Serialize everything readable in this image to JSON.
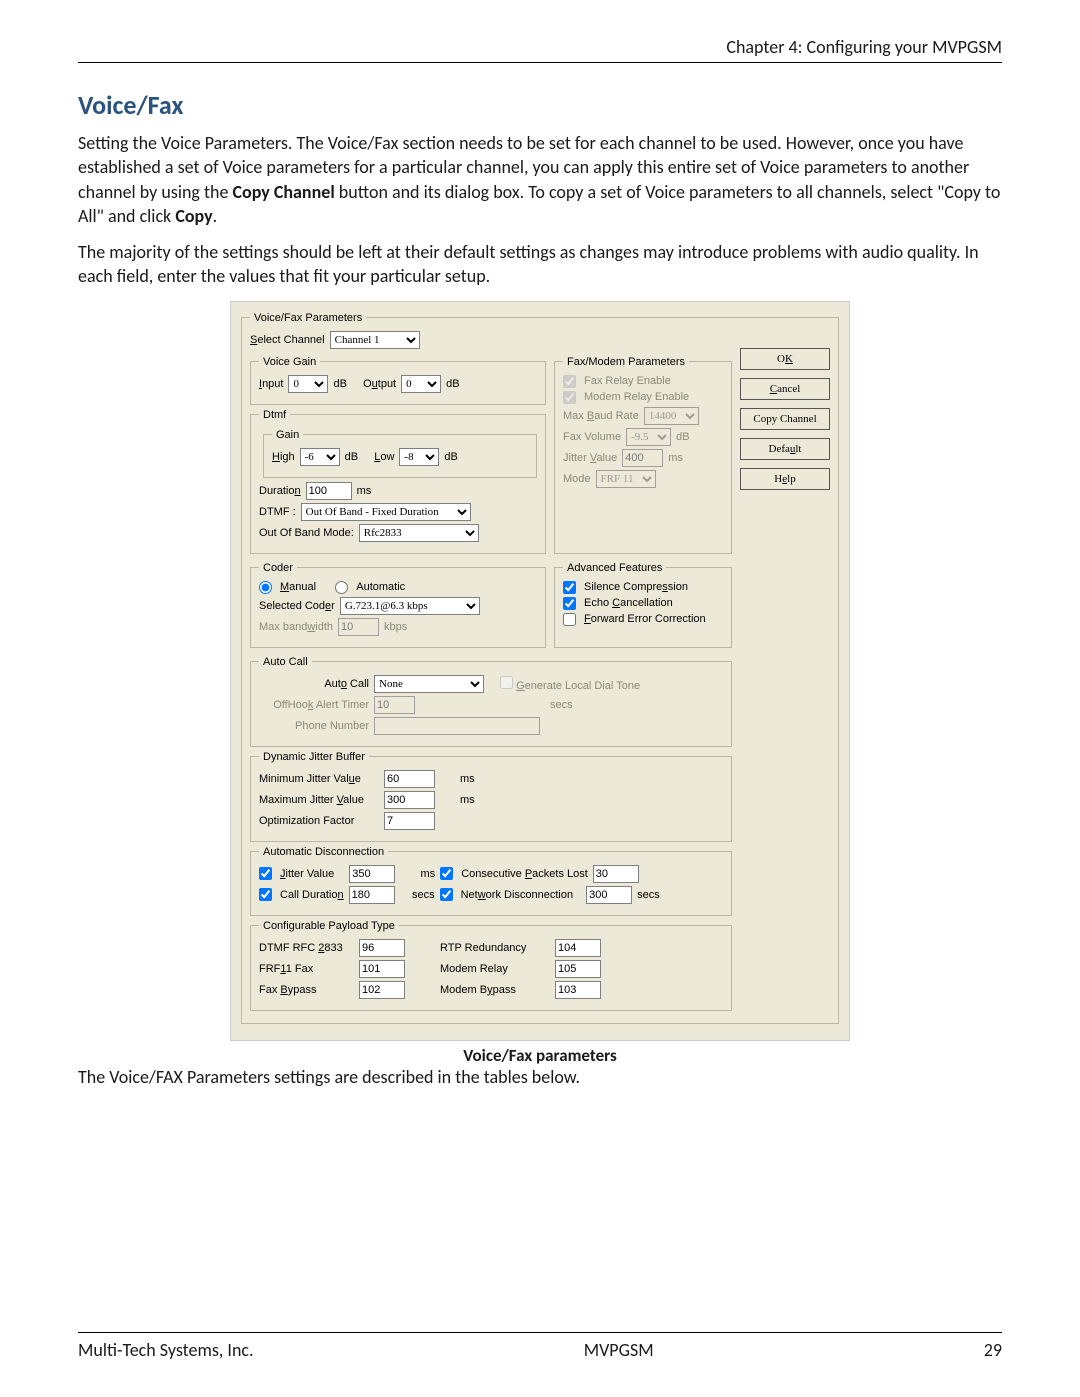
{
  "header": {
    "chapter": "Chapter 4: Configuring your MVPGSM"
  },
  "title": "Voice/Fax",
  "p1a": "Setting the Voice Parameters. The Voice/Fax section needs to be set for each channel to be used. However, once you have established a set of Voice parameters for a particular channel, you can apply this entire set of Voice parameters to another channel by using the ",
  "p1b": "Copy Channel",
  "p1c": " button and its dialog box. To copy a set of Voice parameters to all channels, select \"Copy to All\" and click ",
  "p1d": "Copy",
  "p1e": ".",
  "p2": "The majority of the settings should be left at their default settings as changes may introduce problems with audio quality. In each field, enter the values that fit your particular setup.",
  "caption": "Voice/Fax parameters",
  "after": "The Voice/FAX Parameters settings are described in the tables below.",
  "footer": {
    "left": "Multi-Tech Systems, Inc.",
    "center": "MVPGSM",
    "right": "29"
  },
  "buttons": {
    "ok": "OK",
    "cancel": "Cancel",
    "copy": "Copy Channel",
    "default": "Default",
    "help": "Help"
  },
  "vf": {
    "legend": "Voice/Fax Parameters",
    "selchan_lbl": "Select Channel",
    "selchan_val": "Channel 1",
    "vg": {
      "legend": "Voice Gain",
      "in_lbl": "Input",
      "in_val": "0",
      "out_lbl": "Output",
      "out_val": "0",
      "unit": "dB"
    },
    "dtmf": {
      "legend": "Dtmf",
      "gain": {
        "legend": "Gain",
        "hi_lbl": "High",
        "hi_val": "-6",
        "lo_lbl": "Low",
        "lo_val": "-8",
        "unit": "dB"
      },
      "dur_lbl": "Duration",
      "dur_val": "100",
      "dur_unit": "ms",
      "dtmf_lbl": "DTMF :",
      "dtmf_val": "Out Of Band - Fixed Duration",
      "oob_lbl": "Out Of Band Mode:",
      "oob_val": "Rfc2833"
    },
    "fax": {
      "legend": "Fax/Modem Parameters",
      "fre": "Fax Relay Enable",
      "mre": "Modem Relay Enable",
      "mbr_lbl": "Max Baud Rate",
      "mbr_val": "14400",
      "fv_lbl": "Fax Volume",
      "fv_val": "-9.5",
      "fv_unit": "dB",
      "jv_lbl": "Jitter Value",
      "jv_val": "400",
      "jv_unit": "ms",
      "mode_lbl": "Mode",
      "mode_val": "FRF 11"
    },
    "coder": {
      "legend": "Coder",
      "man": "Manual",
      "auto": "Automatic",
      "sel_lbl": "Selected Coder",
      "sel_val": "G.723.1@6.3 kbps",
      "mbw_lbl": "Max bandwidth",
      "mbw_val": "10",
      "mbw_unit": "kbps"
    },
    "adv": {
      "legend": "Advanced Features",
      "sc": "Silence Compression",
      "ec": "Echo Cancellation",
      "fec": "Forward Error Correction"
    },
    "ac": {
      "legend": "Auto Call",
      "ac_lbl": "Auto Call",
      "ac_val": "None",
      "gldt": "Generate Local Dial Tone",
      "oh_lbl": "OffHook Alert Timer",
      "oh_val": "10",
      "oh_unit": "secs",
      "pn_lbl": "Phone Number",
      "pn_val": ""
    },
    "djb": {
      "legend": "Dynamic Jitter Buffer",
      "min_lbl": "Minimum Jitter Value",
      "min_val": "60",
      "max_lbl": "Maximum Jitter Value",
      "max_val": "300",
      "unit": "ms",
      "opt_lbl": "Optimization Factor",
      "opt_val": "7"
    },
    "ad": {
      "legend": "Automatic Disconnection",
      "jv_lbl": "Jitter Value",
      "jv_val": "350",
      "jv_unit": "ms",
      "cpl_lbl": "Consecutive Packets Lost",
      "cpl_val": "30",
      "cd_lbl": "Call Duration",
      "cd_val": "180",
      "cd_unit": "secs",
      "nd_lbl": "Network Disconnection",
      "nd_val": "300",
      "nd_unit": "secs"
    },
    "cpt": {
      "legend": "Configurable Payload Type",
      "r1l": "DTMF RFC 2833",
      "r1v": "96",
      "r1r": "RTP Redundancy",
      "r1rv": "104",
      "r2l": "FRF11 Fax",
      "r2v": "101",
      "r2r": "Modem Relay",
      "r2rv": "105",
      "r3l": "Fax Bypass",
      "r3v": "102",
      "r3r": "Modem Bypass",
      "r3rv": "103"
    }
  }
}
